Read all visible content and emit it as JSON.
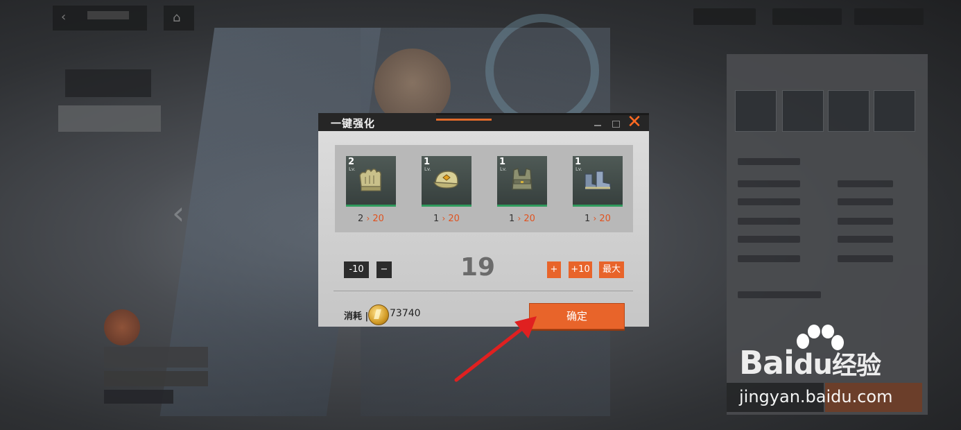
{
  "dialog": {
    "title": "一键强化",
    "items": [
      {
        "level": "2",
        "lv_label": "Lv.",
        "from": "2",
        "to": "20",
        "icon": "gloves-icon"
      },
      {
        "level": "1",
        "lv_label": "Lv.",
        "from": "1",
        "to": "20",
        "icon": "cap-icon"
      },
      {
        "level": "1",
        "lv_label": "Lv.",
        "from": "1",
        "to": "20",
        "icon": "vest-icon"
      },
      {
        "level": "1",
        "lv_label": "Lv.",
        "from": "1",
        "to": "20",
        "icon": "boots-icon"
      }
    ],
    "minus10_label": "-10",
    "minus_label": "−",
    "count": "19",
    "plus_label": "+",
    "plus10_label": "+10",
    "max_label": "最大",
    "cost_label": "消耗 |",
    "cost_value": "73740",
    "confirm_label": "确定"
  },
  "watermark": {
    "logo_text": "Bai",
    "logo_du": "du",
    "logo_suffix": "经验",
    "url": "jingyan.baidu.com"
  },
  "colors": {
    "accent": "#e8642a",
    "close": "#ff6a22",
    "upgrade_target": "#e0521f",
    "item_rarity": "#2f9b5d"
  }
}
